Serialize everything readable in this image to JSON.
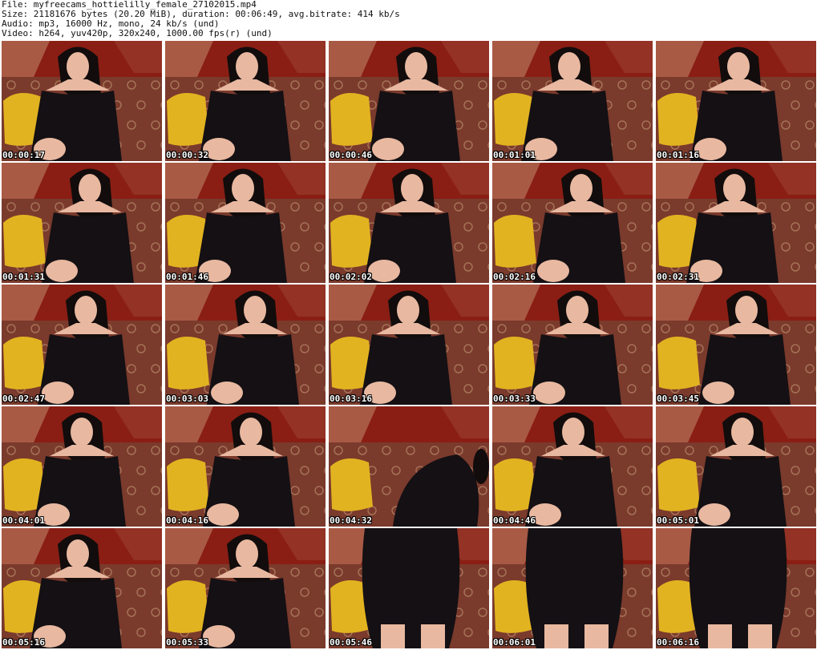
{
  "header": {
    "file": "File: myfreecams_hottielilly_female_27102015.mp4",
    "size": "Size: 21181676 bytes (20.20 MiB), duration: 00:06:49, avg.bitrate: 414 kb/s",
    "audio": "Audio: mp3, 16000 Hz, mono, 24 kb/s (und)",
    "video": "Video: h264, yuv420p, 320x240, 1000.00 fps(r) (und)"
  },
  "colors": {
    "sofa": "#7a3a2c",
    "sofa_pattern": "#c9a07a",
    "curtain": "#8a1e14",
    "curtain_light": "#b5745a",
    "pillow": "#e2b320",
    "dress": "#141014",
    "skin": "#e8b8a0",
    "hair": "#120c0c"
  },
  "thumbnails": [
    {
      "time": "00:00:17",
      "pose": "seated"
    },
    {
      "time": "00:00:32",
      "pose": "seated"
    },
    {
      "time": "00:00:46",
      "pose": "seated"
    },
    {
      "time": "00:01:01",
      "pose": "seated"
    },
    {
      "time": "00:01:16",
      "pose": "seated"
    },
    {
      "time": "00:01:31",
      "pose": "seated"
    },
    {
      "time": "00:01:46",
      "pose": "seated"
    },
    {
      "time": "00:02:02",
      "pose": "seated"
    },
    {
      "time": "00:02:16",
      "pose": "seated"
    },
    {
      "time": "00:02:31",
      "pose": "seated"
    },
    {
      "time": "00:02:47",
      "pose": "seated"
    },
    {
      "time": "00:03:03",
      "pose": "seated"
    },
    {
      "time": "00:03:16",
      "pose": "seated"
    },
    {
      "time": "00:03:33",
      "pose": "seated"
    },
    {
      "time": "00:03:45",
      "pose": "seated"
    },
    {
      "time": "00:04:01",
      "pose": "seated"
    },
    {
      "time": "00:04:16",
      "pose": "seated"
    },
    {
      "time": "00:04:32",
      "pose": "bending"
    },
    {
      "time": "00:04:46",
      "pose": "seated"
    },
    {
      "time": "00:05:01",
      "pose": "seated"
    },
    {
      "time": "00:05:16",
      "pose": "seated"
    },
    {
      "time": "00:05:33",
      "pose": "seated"
    },
    {
      "time": "00:05:46",
      "pose": "standing"
    },
    {
      "time": "00:06:01",
      "pose": "standing"
    },
    {
      "time": "00:06:16",
      "pose": "standing"
    }
  ]
}
